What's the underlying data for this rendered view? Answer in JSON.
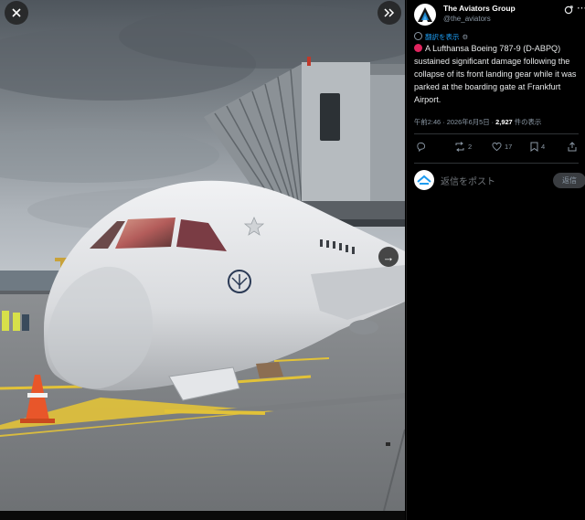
{
  "media": {
    "close_icon": "close-icon",
    "expand_icon": "double-chevron-right-icon",
    "next_icon": "arrow-right-icon",
    "next_glyph": "→"
  },
  "post": {
    "display_name": "The Aviators Group",
    "handle": "@the_aviators",
    "translate_label": "翻訳を表示",
    "text": "A Lufthansa Boeing 787-9 (D-ABPQ) sustained significant damage following the collapse of its front landing gear while it was parked at the boarding gate at Frankfurt Airport.",
    "time": "午前2:46",
    "date": "2026年6月5日",
    "views": "2,927",
    "views_label": "件の表示"
  },
  "actions": {
    "reply_count": "",
    "repost_count": "2",
    "like_count": "17",
    "bookmark_count": "4"
  },
  "reply": {
    "placeholder": "返信をポスト",
    "button": "返信"
  },
  "colors": {
    "accent": "#1d9bf0",
    "red_dot": "#e0245e",
    "background": "#000000"
  }
}
